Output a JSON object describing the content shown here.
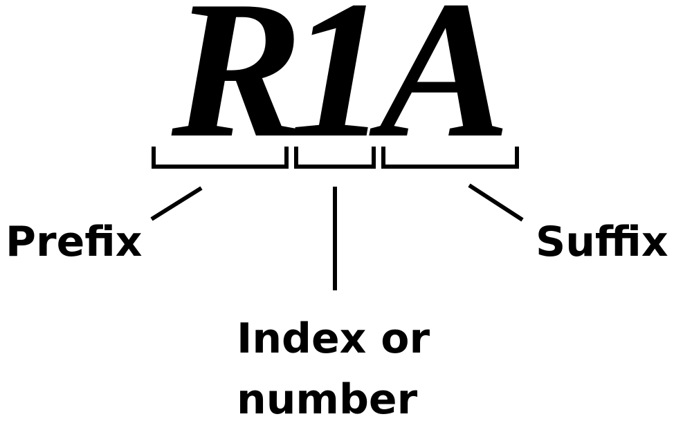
{
  "title": {
    "prefix_letter": "R",
    "index_letter": "1",
    "suffix_letter": "A"
  },
  "labels": {
    "prefix": "Prefix",
    "index_line1": "Index or",
    "index_line2": "number",
    "suffix": "Suffix"
  },
  "colors": {
    "ink": "#000000",
    "background": "#ffffff"
  }
}
